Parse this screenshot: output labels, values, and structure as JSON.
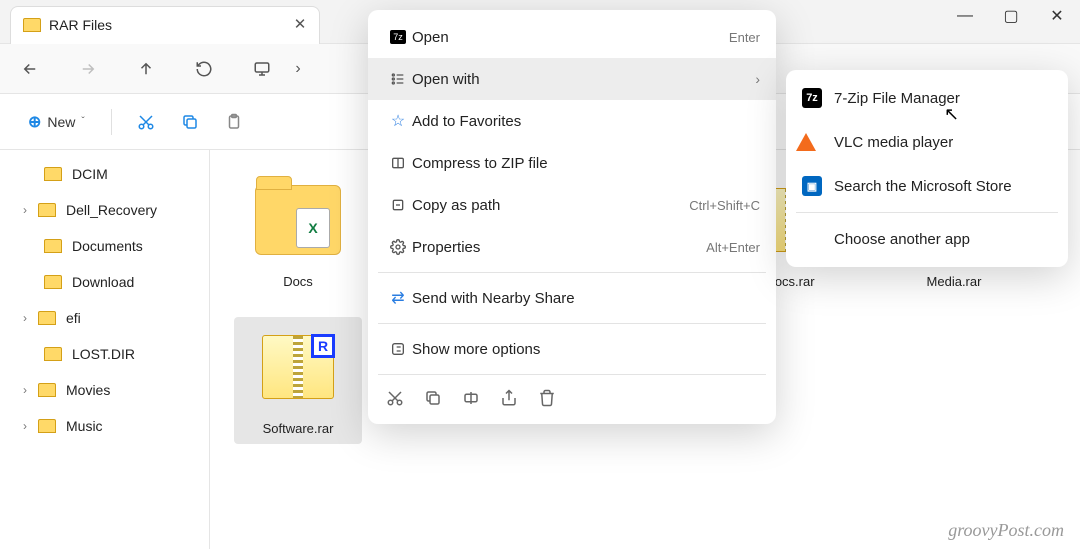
{
  "window_controls": {
    "min": "—",
    "max": "▢",
    "close": "✕"
  },
  "tab": {
    "title": "RAR Files"
  },
  "toolbar": {
    "new_label": "New",
    "items": [
      "Docs",
      "Software.rar",
      "Docs.rar",
      "Media.rar"
    ]
  },
  "sidebar": {
    "items": [
      {
        "label": "DCIM"
      },
      {
        "label": "Dell_Recovery",
        "expandable": true
      },
      {
        "label": "Documents"
      },
      {
        "label": "Download"
      },
      {
        "label": "efi",
        "expandable": true
      },
      {
        "label": "LOST.DIR"
      },
      {
        "label": "Movies",
        "expandable": true
      },
      {
        "label": "Music",
        "expandable": true
      }
    ]
  },
  "files": {
    "docs": "Docs",
    "software": "Software.rar",
    "docsrar": "Docs.rar",
    "mediarar": "Media.rar"
  },
  "context_menu": {
    "open": {
      "label": "Open",
      "hint": "Enter"
    },
    "open_with": {
      "label": "Open with"
    },
    "favorites": {
      "label": "Add to Favorites"
    },
    "compress": {
      "label": "Compress to ZIP file"
    },
    "copy_path": {
      "label": "Copy as path",
      "hint": "Ctrl+Shift+C"
    },
    "properties": {
      "label": "Properties",
      "hint": "Alt+Enter"
    },
    "nearby": {
      "label": "Send with Nearby Share"
    },
    "more": {
      "label": "Show more options"
    }
  },
  "open_with_menu": {
    "sevenzip": "7-Zip File Manager",
    "vlc": "VLC media player",
    "store": "Search the Microsoft Store",
    "another": "Choose another app"
  },
  "watermark": "groovyPost.com"
}
